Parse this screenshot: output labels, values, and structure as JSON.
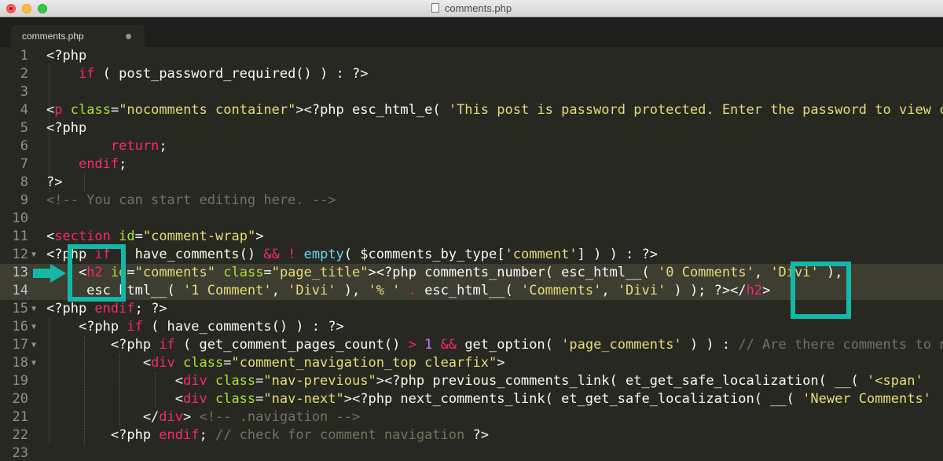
{
  "window": {
    "title": "comments.php",
    "colors": {
      "background": "#272822",
      "tag": "#f92672",
      "attr": "#a6e22e",
      "string": "#e6db74",
      "func": "#66d9ef",
      "comment": "#75715e",
      "annotation": "#14b8a6"
    }
  },
  "tab": {
    "label": "comments.php"
  },
  "lines": [
    {
      "num": "1",
      "fold": "",
      "tokens": [
        {
          "t": "<?php",
          "c": "var"
        }
      ]
    },
    {
      "num": "2",
      "fold": "",
      "tokens": [
        {
          "t": "    ",
          "c": ""
        },
        {
          "t": "if",
          "c": "kw"
        },
        {
          "t": " ( post_password_required() ) : ?>",
          "c": "var"
        }
      ]
    },
    {
      "num": "3",
      "fold": "",
      "tokens": []
    },
    {
      "num": "4",
      "fold": "",
      "tokens": [
        {
          "t": "<",
          "c": "var"
        },
        {
          "t": "p",
          "c": "tag"
        },
        {
          "t": " ",
          "c": ""
        },
        {
          "t": "class",
          "c": "attr"
        },
        {
          "t": "=",
          "c": "var"
        },
        {
          "t": "\"nocomments container\"",
          "c": "str"
        },
        {
          "t": "><?php esc_html_e( ",
          "c": "var"
        },
        {
          "t": "'This post is password protected. Enter the password to view comments.'",
          "c": "str"
        }
      ]
    },
    {
      "num": "5",
      "fold": "",
      "tokens": [
        {
          "t": "<?php",
          "c": "var"
        }
      ]
    },
    {
      "num": "6",
      "fold": "",
      "tokens": [
        {
          "t": "        ",
          "c": ""
        },
        {
          "t": "return",
          "c": "kw"
        },
        {
          "t": ";",
          "c": "var"
        }
      ]
    },
    {
      "num": "7",
      "fold": "",
      "tokens": [
        {
          "t": "    ",
          "c": ""
        },
        {
          "t": "endif",
          "c": "kw"
        },
        {
          "t": ";",
          "c": "var"
        }
      ]
    },
    {
      "num": "8",
      "fold": "",
      "tokens": [
        {
          "t": "?>",
          "c": "var"
        }
      ]
    },
    {
      "num": "9",
      "fold": "",
      "tokens": [
        {
          "t": "<!-- You can start editing here. -->",
          "c": "cmt"
        }
      ]
    },
    {
      "num": "10",
      "fold": "",
      "tokens": []
    },
    {
      "num": "11",
      "fold": "",
      "tokens": [
        {
          "t": "<",
          "c": "var"
        },
        {
          "t": "section",
          "c": "tag"
        },
        {
          "t": " ",
          "c": ""
        },
        {
          "t": "id",
          "c": "attr"
        },
        {
          "t": "=",
          "c": "var"
        },
        {
          "t": "\"comment-wrap\"",
          "c": "str"
        },
        {
          "t": ">",
          "c": "var"
        }
      ]
    },
    {
      "num": "12",
      "fold": "▼",
      "tokens": [
        {
          "t": "<?php ",
          "c": "var"
        },
        {
          "t": "if",
          "c": "kw"
        },
        {
          "t": " ( have_comments() ",
          "c": "var"
        },
        {
          "t": "&&",
          "c": "kw"
        },
        {
          "t": " ",
          "c": ""
        },
        {
          "t": "!",
          "c": "kw"
        },
        {
          "t": " ",
          "c": ""
        },
        {
          "t": "empty",
          "c": "fn"
        },
        {
          "t": "( $comments_by_type[",
          "c": "var"
        },
        {
          "t": "'comment'",
          "c": "str"
        },
        {
          "t": "] ) ) : ?>",
          "c": "var"
        }
      ]
    },
    {
      "num": "13",
      "fold": "",
      "hl": true,
      "tokens": [
        {
          "t": "    <",
          "c": "var"
        },
        {
          "t": "h2",
          "c": "tag"
        },
        {
          "t": " ",
          "c": ""
        },
        {
          "t": "id",
          "c": "attr"
        },
        {
          "t": "=",
          "c": "var"
        },
        {
          "t": "\"comments\"",
          "c": "str"
        },
        {
          "t": " ",
          "c": ""
        },
        {
          "t": "class",
          "c": "attr"
        },
        {
          "t": "=",
          "c": "var"
        },
        {
          "t": "\"page_title\"",
          "c": "str"
        },
        {
          "t": "><?php comments_number( esc_html__( ",
          "c": "var"
        },
        {
          "t": "'0 Comments'",
          "c": "str"
        },
        {
          "t": ", ",
          "c": "var"
        },
        {
          "t": "'Divi'",
          "c": "str"
        },
        {
          "t": " ),",
          "c": "var"
        }
      ]
    },
    {
      "num": "14",
      "fold": "",
      "hl": true,
      "tokens": [
        {
          "t": "     esc_html__( ",
          "c": "var"
        },
        {
          "t": "'1 Comment'",
          "c": "str"
        },
        {
          "t": ", ",
          "c": "var"
        },
        {
          "t": "'Divi'",
          "c": "str"
        },
        {
          "t": " ), ",
          "c": "var"
        },
        {
          "t": "'% '",
          "c": "str"
        },
        {
          "t": " ",
          "c": ""
        },
        {
          "t": ".",
          "c": "kw"
        },
        {
          "t": " esc_html__( ",
          "c": "var"
        },
        {
          "t": "'Comments'",
          "c": "str"
        },
        {
          "t": ", ",
          "c": "var"
        },
        {
          "t": "'Divi'",
          "c": "str"
        },
        {
          "t": " ) ); ?></",
          "c": "var"
        },
        {
          "t": "h2",
          "c": "tag"
        },
        {
          "t": ">",
          "c": "var"
        }
      ]
    },
    {
      "num": "15",
      "fold": "▼",
      "tokens": [
        {
          "t": "<?php ",
          "c": "var"
        },
        {
          "t": "endif",
          "c": "kw"
        },
        {
          "t": "; ?>",
          "c": "var"
        }
      ]
    },
    {
      "num": "16",
      "fold": "▼",
      "tokens": [
        {
          "t": "    <?php ",
          "c": "var"
        },
        {
          "t": "if",
          "c": "kw"
        },
        {
          "t": " ( have_comments() ) : ?>",
          "c": "var"
        }
      ]
    },
    {
      "num": "17",
      "fold": "▼",
      "tokens": [
        {
          "t": "        <?php ",
          "c": "var"
        },
        {
          "t": "if",
          "c": "kw"
        },
        {
          "t": " ( get_comment_pages_count() ",
          "c": "var"
        },
        {
          "t": ">",
          "c": "kw"
        },
        {
          "t": " ",
          "c": ""
        },
        {
          "t": "1",
          "c": "num"
        },
        {
          "t": " ",
          "c": ""
        },
        {
          "t": "&&",
          "c": "kw"
        },
        {
          "t": " get_option( ",
          "c": "var"
        },
        {
          "t": "'page_comments'",
          "c": "str"
        },
        {
          "t": " ) ) : ",
          "c": "var"
        },
        {
          "t": "// Are there comments to navigate through?",
          "c": "cmt"
        }
      ]
    },
    {
      "num": "18",
      "fold": "▼",
      "tokens": [
        {
          "t": "            <",
          "c": "var"
        },
        {
          "t": "div",
          "c": "tag"
        },
        {
          "t": " ",
          "c": ""
        },
        {
          "t": "class",
          "c": "attr"
        },
        {
          "t": "=",
          "c": "var"
        },
        {
          "t": "\"comment_navigation_top clearfix\"",
          "c": "str"
        },
        {
          "t": ">",
          "c": "var"
        }
      ]
    },
    {
      "num": "19",
      "fold": "",
      "tokens": [
        {
          "t": "                <",
          "c": "var"
        },
        {
          "t": "div",
          "c": "tag"
        },
        {
          "t": " ",
          "c": ""
        },
        {
          "t": "class",
          "c": "attr"
        },
        {
          "t": "=",
          "c": "var"
        },
        {
          "t": "\"nav-previous\"",
          "c": "str"
        },
        {
          "t": "><?php previous_comments_link( et_get_safe_localization( __( ",
          "c": "var"
        },
        {
          "t": "'<span'",
          "c": "str"
        }
      ]
    },
    {
      "num": "20",
      "fold": "",
      "tokens": [
        {
          "t": "                <",
          "c": "var"
        },
        {
          "t": "div",
          "c": "tag"
        },
        {
          "t": " ",
          "c": ""
        },
        {
          "t": "class",
          "c": "attr"
        },
        {
          "t": "=",
          "c": "var"
        },
        {
          "t": "\"nav-next\"",
          "c": "str"
        },
        {
          "t": "><?php next_comments_link( et_get_safe_localization( __( ",
          "c": "var"
        },
        {
          "t": "'Newer Comments'",
          "c": "str"
        }
      ]
    },
    {
      "num": "21",
      "fold": "",
      "tokens": [
        {
          "t": "            </",
          "c": "var"
        },
        {
          "t": "div",
          "c": "tag"
        },
        {
          "t": "> ",
          "c": "var"
        },
        {
          "t": "<!-- .navigation -->",
          "c": "cmt"
        }
      ]
    },
    {
      "num": "22",
      "fold": "",
      "tokens": [
        {
          "t": "        <?php ",
          "c": "var"
        },
        {
          "t": "endif",
          "c": "kw"
        },
        {
          "t": "; ",
          "c": "var"
        },
        {
          "t": "// check for comment navigation",
          "c": "cmt"
        },
        {
          "t": " ?>",
          "c": "var"
        }
      ]
    },
    {
      "num": "23",
      "fold": "",
      "tokens": []
    }
  ]
}
